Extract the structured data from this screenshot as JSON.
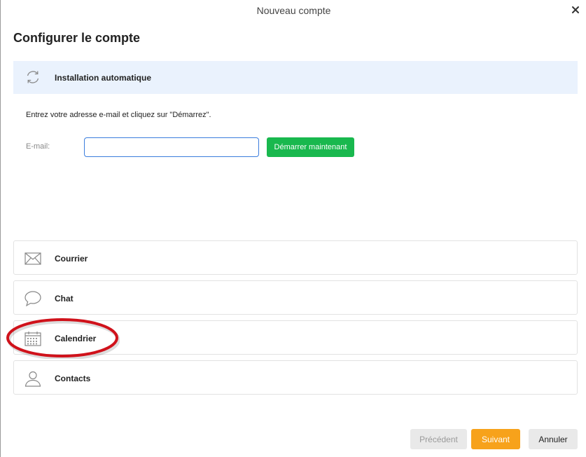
{
  "window": {
    "title": "Nouveau compte"
  },
  "page": {
    "title": "Configurer le compte"
  },
  "auto_setup": {
    "label": "Installation automatique",
    "icon": "refresh-icon",
    "instruction": "Entrez votre adresse e-mail et cliquez sur \"Démarrez\".",
    "email_label": "E-mail:",
    "email_value": "",
    "start_label": "Démarrer maintenant"
  },
  "services": [
    {
      "label": "Courrier",
      "icon": "mail-icon"
    },
    {
      "label": "Chat",
      "icon": "chat-bubble-icon"
    },
    {
      "label": "Calendrier",
      "icon": "calendar-icon"
    },
    {
      "label": "Contacts",
      "icon": "person-icon"
    }
  ],
  "footer": {
    "prev_label": "Précédent",
    "next_label": "Suivant",
    "cancel_label": "Annuler"
  },
  "colors": {
    "accent_green": "#19b84e",
    "accent_orange": "#f7a21b",
    "highlight_red": "#d0121b",
    "auto_setup_bg": "#eaf2fd"
  }
}
